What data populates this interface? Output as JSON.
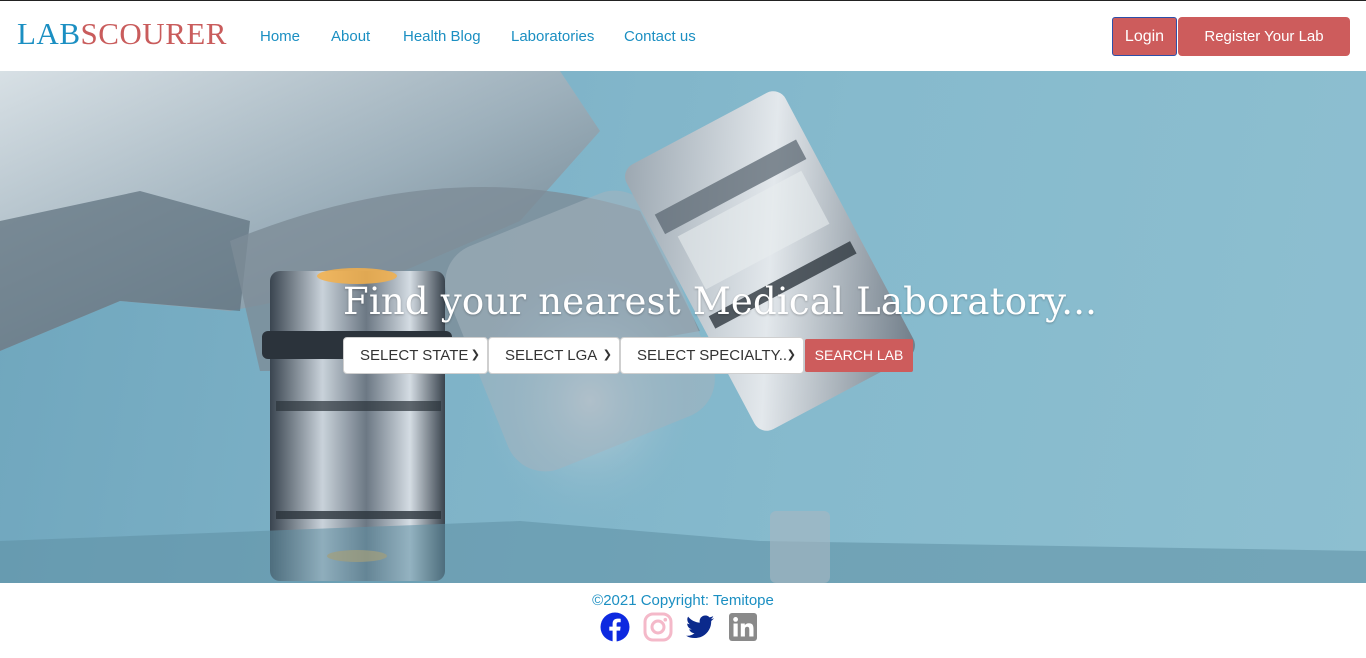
{
  "brand": {
    "part1": "LAB",
    "part2": "SCOURER"
  },
  "nav": {
    "links": [
      "Home",
      "About",
      "Health Blog",
      "Laboratories",
      "Contact us"
    ],
    "login_label": "Login",
    "register_label": "Register Your Lab"
  },
  "hero": {
    "headline": "Find your nearest Medical Laboratory...",
    "select_state": "SELECT STATE",
    "select_lga": "SELECT LGA",
    "select_specialty": "SELECT SPECIALTY..",
    "search_label": "SEARCH LAB"
  },
  "footer": {
    "copyright": "©2021 Copyright: Temitope",
    "social": [
      {
        "icon": "facebook-icon",
        "color": "#0d29e0"
      },
      {
        "icon": "instagram-icon",
        "color": "#f4b9c9"
      },
      {
        "icon": "twitter-icon",
        "color": "#0b2a8c"
      },
      {
        "icon": "linkedin-icon",
        "color": "#8a8a8a"
      }
    ]
  },
  "colors": {
    "primary": "#1b8fc2",
    "accent": "#cd5c5c"
  }
}
